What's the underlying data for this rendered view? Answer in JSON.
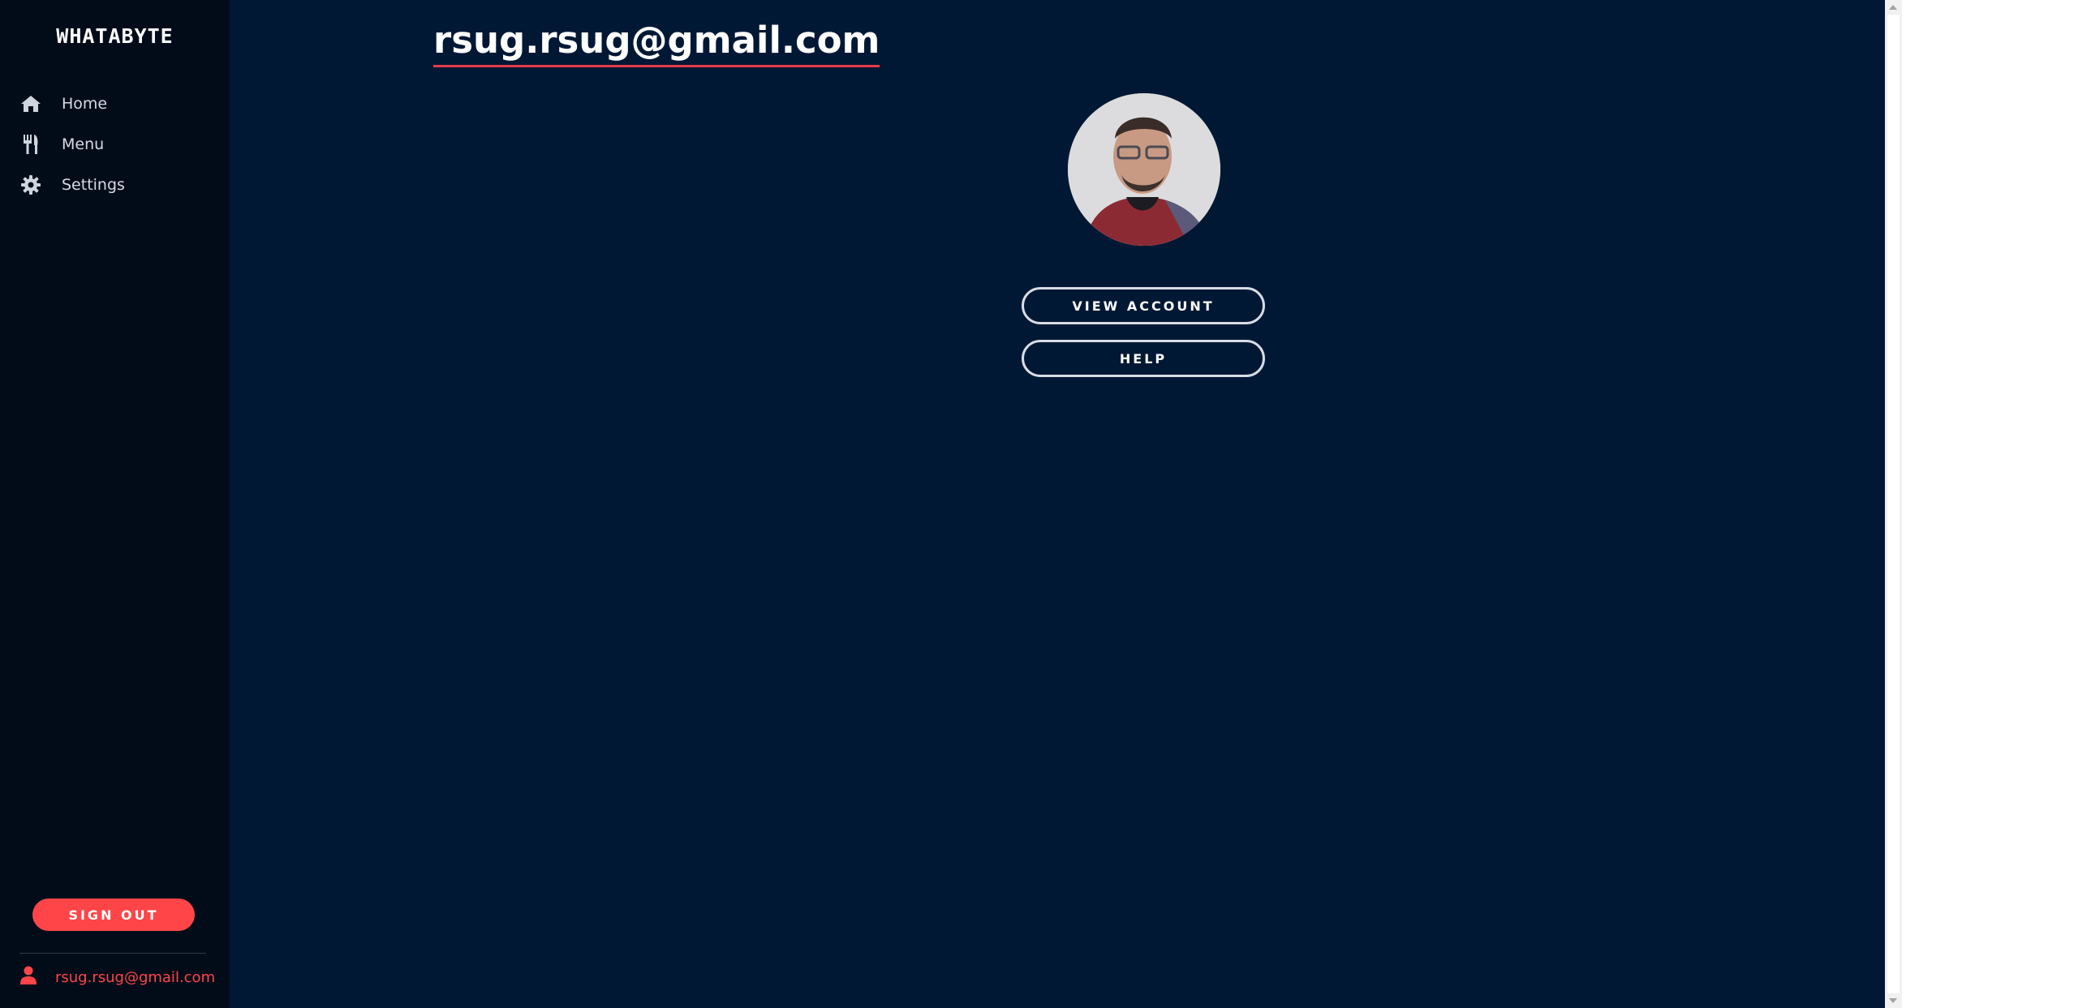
{
  "sidebar": {
    "brand": "WHATABYTE",
    "items": [
      {
        "label": "Home",
        "icon": "home-icon"
      },
      {
        "label": "Menu",
        "icon": "utensils-icon"
      },
      {
        "label": "Settings",
        "icon": "gear-icon"
      }
    ],
    "signout_label": "SIGN OUT",
    "user_email": "rsug.rsug@gmail.com"
  },
  "main": {
    "title": "rsug.rsug@gmail.com",
    "view_account_label": "VIEW ACCOUNT",
    "help_label": "HELP"
  },
  "colors": {
    "sidebar_bg": "#020c19",
    "main_bg": "#001834",
    "accent": "#ff4548",
    "button_outline": "#d8dde4"
  }
}
